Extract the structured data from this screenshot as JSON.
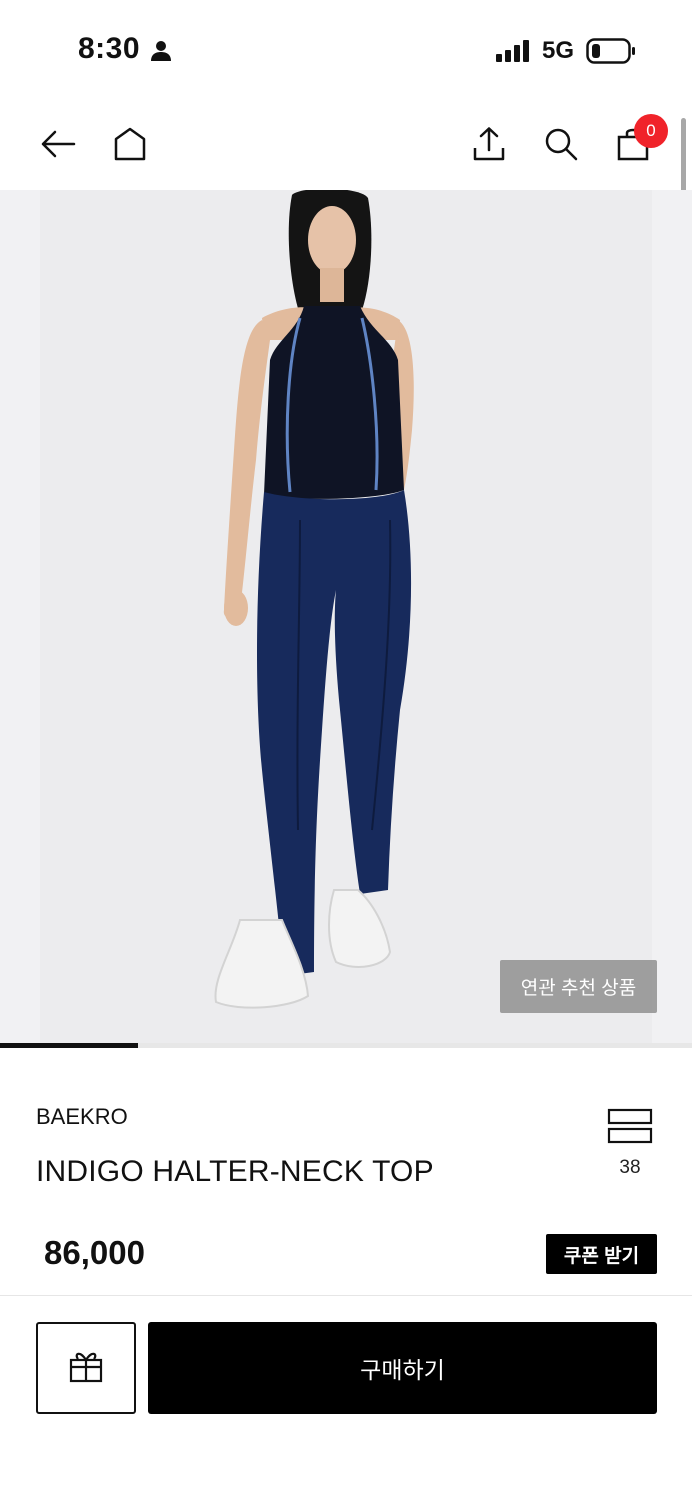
{
  "status_bar": {
    "time": "8:30",
    "network": "5G"
  },
  "nav": {
    "cart_count": "0"
  },
  "hero": {
    "related_label": "연관 추천 상품",
    "carousel_progress": 0.2
  },
  "product": {
    "brand": "BAEKRO",
    "name": "INDIGO HALTER-NECK TOP",
    "list_count": "38",
    "price": "86,000",
    "coupon_label": "쿠폰 받기"
  },
  "actions": {
    "buy_label": "구매하기"
  },
  "colors": {
    "badge": "#f0232a",
    "primary_button": "#000000",
    "image_background": "#ececee"
  },
  "icons": [
    "person-icon",
    "signal-icon",
    "battery-icon",
    "back-arrow-icon",
    "home-icon",
    "share-icon",
    "search-icon",
    "cart-icon",
    "list-icon",
    "gift-icon"
  ]
}
